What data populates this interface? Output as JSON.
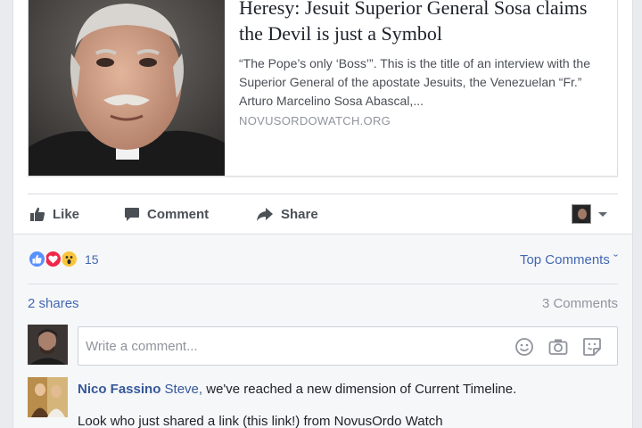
{
  "link_preview": {
    "title": "Heresy: Jesuit Superior General Sosa claims the Devil is just a Symbol",
    "description": "“The Pope’s only ‘Boss’”. This is the title of an interview with the Superior General of the apostate Jesuits, the Venezuelan “Fr.” Arturo Marcelino Sosa Abascal,...",
    "domain": "NOVUSORDOWATCH.ORG"
  },
  "actions": {
    "like": "Like",
    "comment": "Comment",
    "share": "Share"
  },
  "reactions": {
    "count": "15",
    "types": [
      "like-icon",
      "love-icon",
      "wow-icon"
    ],
    "colors": {
      "like": "#5890ff",
      "love": "#f0284a",
      "wow": "#fbc53b"
    }
  },
  "comments_sort": {
    "label": "Top Comments ˇ"
  },
  "stats": {
    "shares": "2 shares",
    "comments": "3 Comments"
  },
  "composer": {
    "placeholder": "Write a comment..."
  },
  "comment": {
    "author": "Nico Fassino",
    "mention": "Steve,",
    "text": " we've reached a new dimension of Current Timeline.",
    "second_line": "Look who just shared a link (this link!) from NovusOrdo Watch"
  },
  "colors": {
    "link": "#4267b2",
    "author": "#365899",
    "secondary_text": "#90949c",
    "page_background": "#e9ebee"
  }
}
